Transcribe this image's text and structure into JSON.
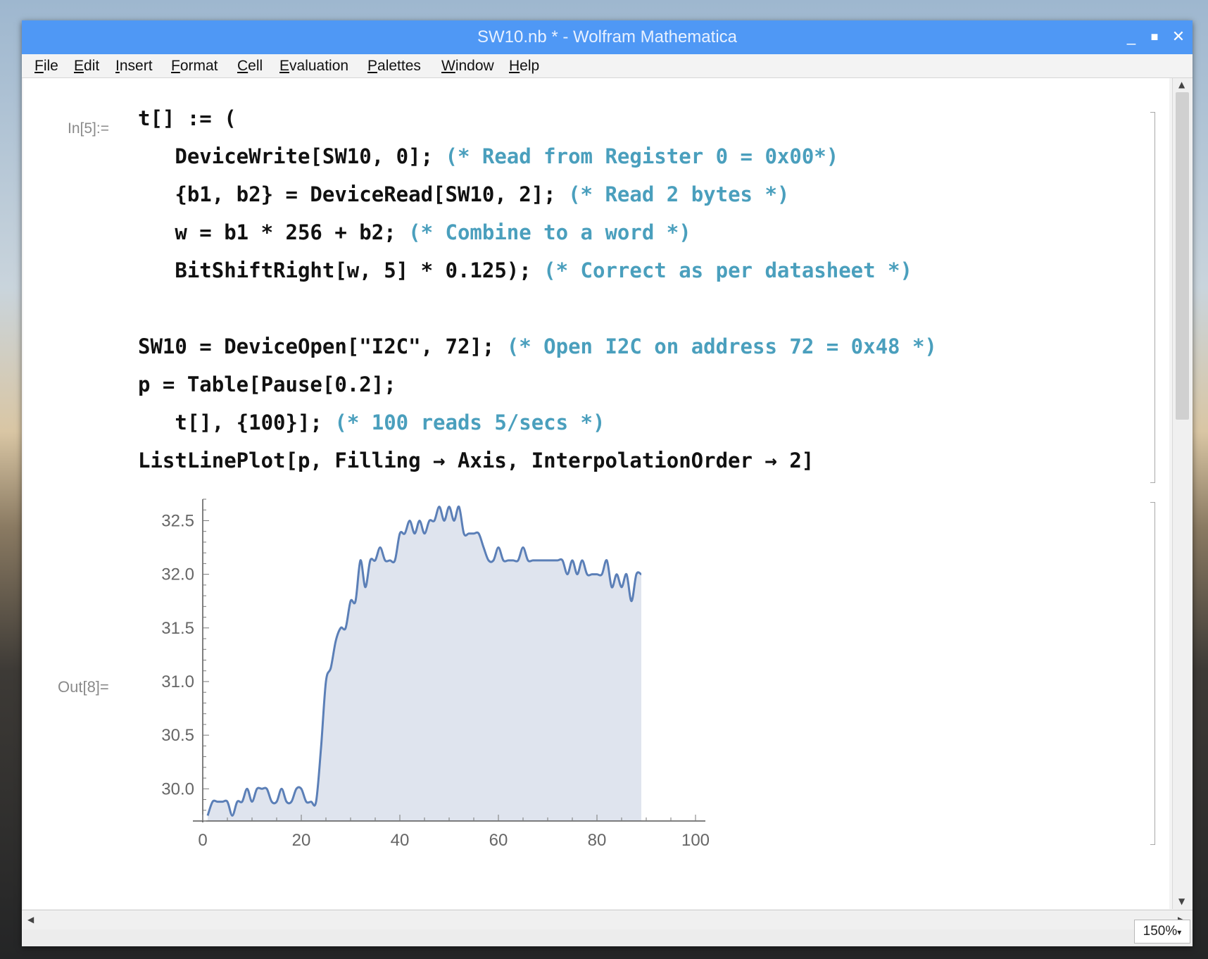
{
  "window": {
    "title": "SW10.nb * - Wolfram Mathematica"
  },
  "menu": [
    "File",
    "Edit",
    "Insert",
    "Format",
    "Cell",
    "Evaluation",
    "Palettes",
    "Window",
    "Help"
  ],
  "cells": {
    "in_label": "In[5]:=",
    "out_label": "Out[8]=",
    "lines": [
      {
        "code": "t[] := (",
        "comment": ""
      },
      {
        "code": "   DeviceWrite[SW10, 0]; ",
        "comment": "(* Read from Register 0 = 0x00*)"
      },
      {
        "code": "   {b1, b2} = DeviceRead[SW10, 2]; ",
        "comment": "(* Read 2 bytes *)"
      },
      {
        "code": "   w = b1 * 256 + b2; ",
        "comment": "(* Combine to a word *)"
      },
      {
        "code": "   BitShiftRight[w, 5] * 0.125); ",
        "comment": "(* Correct as per datasheet *)"
      },
      {
        "code": "",
        "comment": ""
      },
      {
        "code": "SW10 = DeviceOpen[\"I2C\", 72]; ",
        "comment": "(* Open I2C on address 72 = 0x48 *)"
      },
      {
        "code": "p = Table[Pause[0.2];",
        "comment": ""
      },
      {
        "code": "   t[], {100}]; ",
        "comment": "(* 100 reads 5/secs *)"
      },
      {
        "code": "ListLinePlot[p, Filling → Axis, InterpolationOrder → 2]",
        "comment": ""
      }
    ]
  },
  "zoom": "150%",
  "colors": {
    "line": "#5b7fb7",
    "fill": "#dfe4ee",
    "comment": "#4a9fbd",
    "titlebar": "#4f98f5"
  },
  "chart_data": {
    "type": "area",
    "xlim": [
      0,
      100
    ],
    "ylim": [
      29.7,
      32.7
    ],
    "x_ticks": [
      0,
      20,
      40,
      60,
      80,
      100
    ],
    "y_ticks": [
      30.0,
      30.5,
      31.0,
      31.5,
      32.0,
      32.5
    ],
    "y_tick_labels": [
      "30.0",
      "30.5",
      "31.0",
      "31.5",
      "32.0",
      "32.5"
    ],
    "x_tick_labels": [
      "0",
      "20",
      "40",
      "60",
      "80",
      "100"
    ],
    "series": [
      {
        "values": [
          29.75,
          29.88,
          29.88,
          29.88,
          29.88,
          29.75,
          29.88,
          29.88,
          30.0,
          29.88,
          30.0,
          30.0,
          30.0,
          29.88,
          29.88,
          30.0,
          29.88,
          29.88,
          30.0,
          30.0,
          29.88,
          29.88,
          29.88,
          30.38,
          31.0,
          31.13,
          31.38,
          31.5,
          31.5,
          31.75,
          31.75,
          32.13,
          31.88,
          32.13,
          32.13,
          32.25,
          32.13,
          32.13,
          32.13,
          32.38,
          32.38,
          32.5,
          32.38,
          32.5,
          32.38,
          32.5,
          32.5,
          32.63,
          32.5,
          32.63,
          32.5,
          32.63,
          32.38,
          32.38,
          32.38,
          32.38,
          32.25,
          32.13,
          32.13,
          32.25,
          32.13,
          32.13,
          32.13,
          32.13,
          32.25,
          32.13,
          32.13,
          32.13,
          32.13,
          32.13,
          32.13,
          32.13,
          32.13,
          32.0,
          32.13,
          32.0,
          32.13,
          32.0,
          32.0,
          32.0,
          32.0,
          32.13,
          31.88,
          32.0,
          31.88,
          32.0,
          31.75,
          32.0,
          32.0
        ]
      }
    ]
  }
}
